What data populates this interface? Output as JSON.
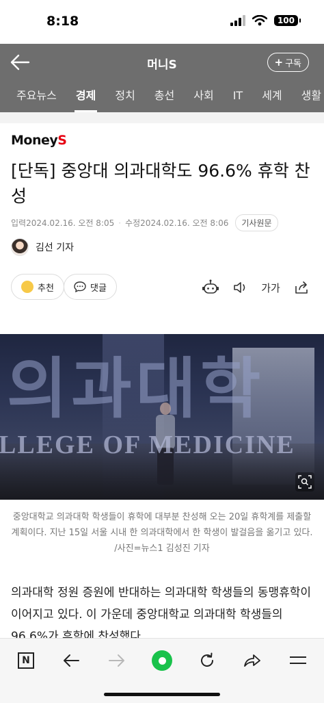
{
  "status_bar": {
    "time": "8:18",
    "battery": "100"
  },
  "header": {
    "title": "머니S",
    "subscribe_label": "구독",
    "tabs": [
      {
        "label": "주요뉴스",
        "active": false
      },
      {
        "label": "경제",
        "active": true
      },
      {
        "label": "정치",
        "active": false
      },
      {
        "label": "총선",
        "active": false
      },
      {
        "label": "사회",
        "active": false
      },
      {
        "label": "IT",
        "active": false
      },
      {
        "label": "세계",
        "active": false
      },
      {
        "label": "생활",
        "active": false
      }
    ]
  },
  "article": {
    "brand_main": "Money",
    "brand_accent": "S",
    "headline": "[단독] 중앙대 의과대학도 96.6% 휴학 찬성",
    "published": "입력2024.02.16. 오전 8:05",
    "modified": "수정2024.02.16. 오전 8:06",
    "original_link": "기사원문",
    "author": "김선 기자",
    "like_label": "추천",
    "comment_label": "댓글",
    "font_size_label": "가가",
    "photo_text_large": "의과대학",
    "photo_text_sub": "LLEGE OF MEDICINE",
    "caption": "중앙대학교 의과대학 학생들이 휴학에 대부분 찬성해 오는 20일 휴학계를 제출할 계획이다. 지난 15일 서울 시내 한 의과대학에서 한 학생이 발걸음을 옮기고 있다. /사진=뉴스1 김성진 기자",
    "body_text": "의과대학 정원 증원에 반대하는 의과대학 학생들의 동맹휴학이 이어지고 있다. 이 가운데 중앙대학교 의과대학 학생들의 96.6%가 휴학에 찬성했다."
  },
  "bottom_bar": {
    "n_label": "N"
  },
  "colors": {
    "header_bg": "#6e6e6e",
    "brand_accent": "#e60012",
    "green": "#19c24b"
  }
}
